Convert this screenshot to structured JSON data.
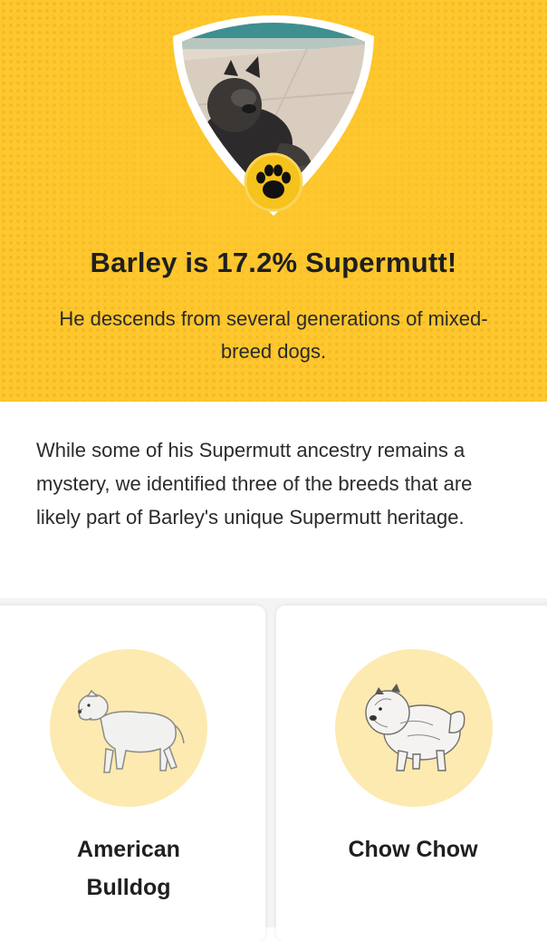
{
  "hero": {
    "title": "Barley is 17.2% Supermutt!",
    "subtitle": "He descends from several generations of mixed-breed dogs.",
    "badge_icon": "paw-icon",
    "colors": {
      "background": "#fec72e",
      "badge_border": "#ffffff",
      "paw_circle": "#f6c21c",
      "paw": "#111111"
    }
  },
  "intro": {
    "text": "While some of his Supermutt ancestry remains a mystery, we identified three of the breeds that are likely part of Barley's unique Supermutt heritage."
  },
  "breeds": [
    {
      "name": "American Bulldog",
      "image": "american-bulldog-illustration"
    },
    {
      "name": "Chow Chow",
      "image": "chow-chow-illustration"
    }
  ],
  "colors": {
    "breed_circle": "#fdeab0",
    "text": "#1f1f1f"
  }
}
